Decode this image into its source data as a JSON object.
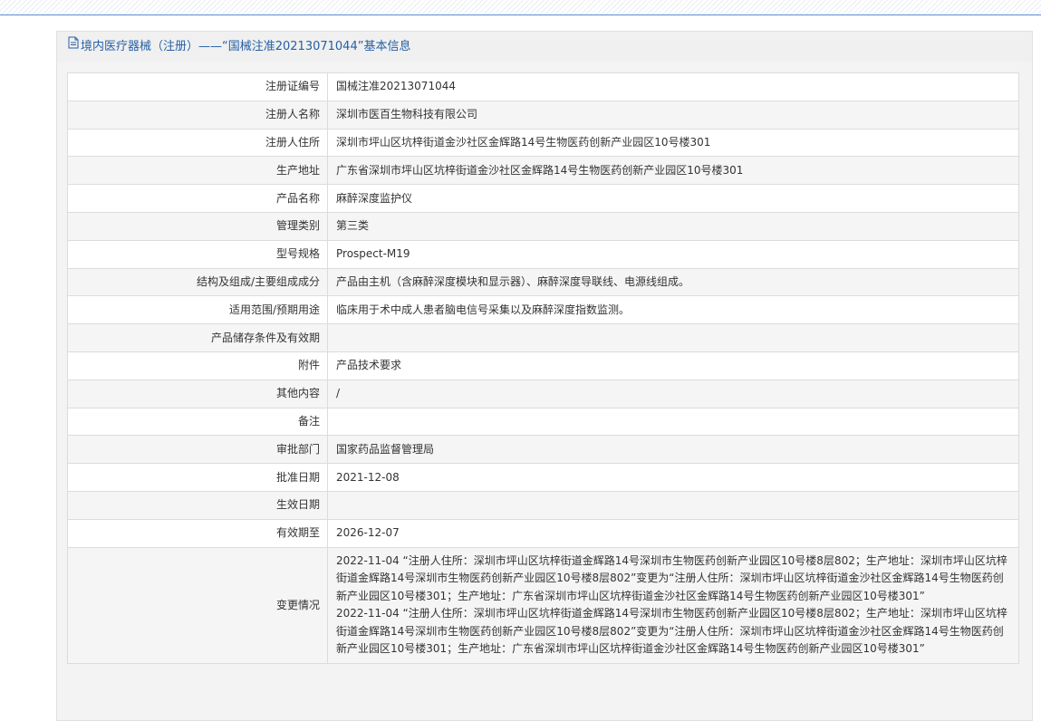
{
  "header": {
    "title": "境内医疗器械（注册）——“国械注准20213071044”基本信息"
  },
  "rows": [
    {
      "label": "注册证编号",
      "value": "国械注准20213071044"
    },
    {
      "label": "注册人名称",
      "value": "深圳市医百生物科技有限公司"
    },
    {
      "label": "注册人住所",
      "value": "深圳市坪山区坑梓街道金沙社区金辉路14号生物医药创新产业园区10号楼301"
    },
    {
      "label": "生产地址",
      "value": "广东省深圳市坪山区坑梓街道金沙社区金辉路14号生物医药创新产业园区10号楼301"
    },
    {
      "label": "产品名称",
      "value": "麻醉深度监护仪"
    },
    {
      "label": "管理类别",
      "value": "第三类"
    },
    {
      "label": "型号规格",
      "value": "Prospect-M19"
    },
    {
      "label": "结构及组成/主要组成成分",
      "value": "产品由主机（含麻醉深度模块和显示器）、麻醉深度导联线、电源线组成。"
    },
    {
      "label": "适用范围/预期用途",
      "value": "临床用于术中成人患者脑电信号采集以及麻醉深度指数监测。"
    },
    {
      "label": "产品储存条件及有效期",
      "value": ""
    },
    {
      "label": "附件",
      "value": "产品技术要求"
    },
    {
      "label": "其他内容",
      "value": "/"
    },
    {
      "label": "备注",
      "value": ""
    },
    {
      "label": "审批部门",
      "value": "国家药品监督管理局"
    },
    {
      "label": "批准日期",
      "value": "2021-12-08"
    },
    {
      "label": "生效日期",
      "value": ""
    },
    {
      "label": "有效期至",
      "value": "2026-12-07"
    }
  ],
  "change": {
    "label": "变更情况",
    "entries": [
      "2022-11-04 “注册人住所：深圳市坪山区坑梓街道金辉路14号深圳市生物医药创新产业园区10号楼8层802；生产地址：深圳市坪山区坑梓街道金辉路14号深圳市生物医药创新产业园区10号楼8层802”变更为“注册人住所：深圳市坪山区坑梓街道金沙社区金辉路14号生物医药创新产业园区10号楼301；生产地址：广东省深圳市坪山区坑梓街道金沙社区金辉路14号生物医药创新产业园区10号楼301”",
      "2022-11-04 “注册人住所：深圳市坪山区坑梓街道金辉路14号深圳市生物医药创新产业园区10号楼8层802；生产地址：深圳市坪山区坑梓街道金辉路14号深圳市生物医药创新产业园区10号楼8层802”变更为“注册人住所：深圳市坪山区坑梓街道金沙社区金辉路14号生物医药创新产业园区10号楼301；生产地址：广东省深圳市坪山区坑梓街道金沙社区金辉路14号生物医药创新产业园区10号楼301”"
    ]
  }
}
